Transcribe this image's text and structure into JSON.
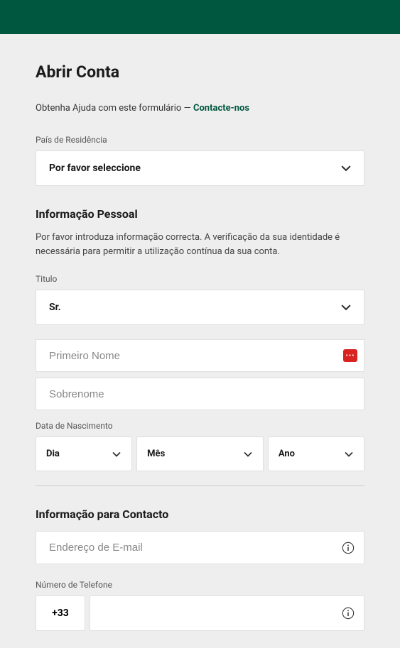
{
  "header": {},
  "page": {
    "title": "Abrir Conta",
    "helpPrefix": "Obtenha Ajuda com este formulário — ",
    "helpLink": "Contacte-nos"
  },
  "residence": {
    "label": "País de Residência",
    "value": "Por favor seleccione"
  },
  "personalInfo": {
    "title": "Informação Pessoal",
    "description": "Por favor introduza informação correcta. A verificação da sua identidade é necessária para permitir a utilização contínua da sua conta.",
    "titleField": {
      "label": "Titulo",
      "value": "Sr."
    },
    "firstName": {
      "placeholder": "Primeiro Nome"
    },
    "lastName": {
      "placeholder": "Sobrenome"
    },
    "dob": {
      "label": "Data de Nascimento",
      "day": "Dia",
      "month": "Mês",
      "year": "Ano"
    }
  },
  "contactInfo": {
    "title": "Informação para Contacto",
    "email": {
      "placeholder": "Endereço de E-mail"
    },
    "phone": {
      "label": "Número de Telefone",
      "prefix": "+33"
    }
  }
}
